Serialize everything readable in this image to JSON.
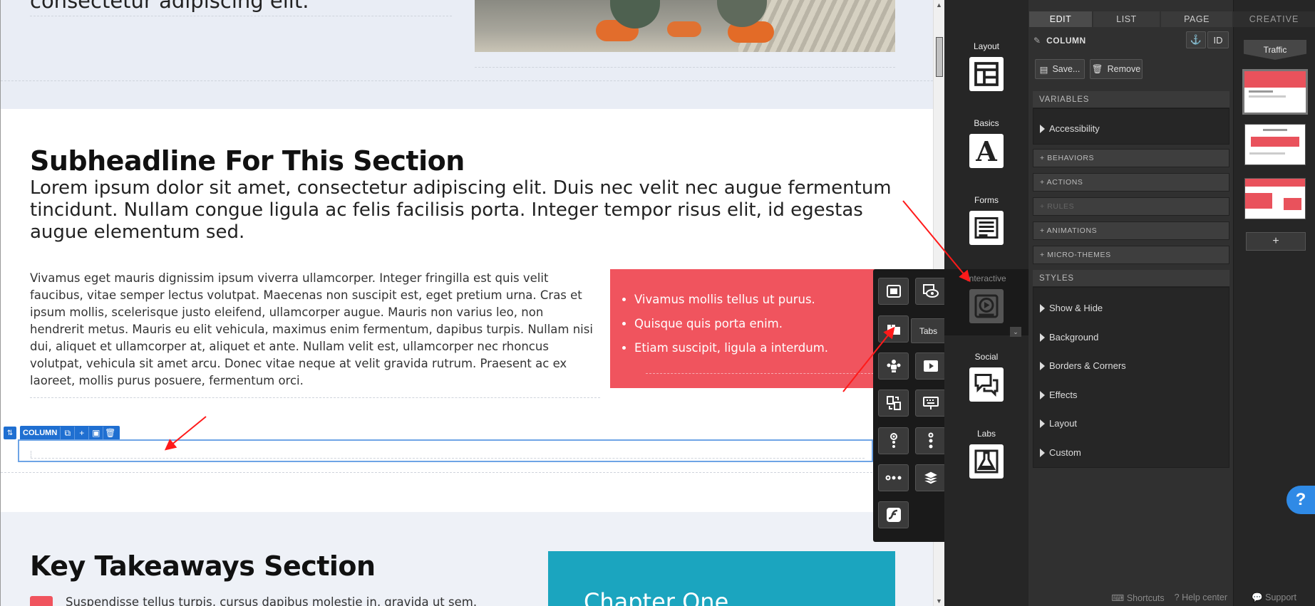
{
  "canvas": {
    "top_text": "consectetur adipiscing elit.",
    "subheadline": "Subheadline For This Section",
    "lead": "Lorem ipsum dolor sit amet, consectetur adipiscing elit. Duis nec velit nec augue fermentum tincidunt. Nullam congue ligula ac felis facilisis porta. Integer tempor risus elit, id egestas augue elementum sed.",
    "body": "Vivamus eget mauris dignissim ipsum viverra ullamcorper. Integer fringilla est quis velit faucibus, vitae semper lectus volutpat. Maecenas non suscipit est, eget pretium urna. Cras et ipsum mollis, scelerisque justo eleifend, ullamcorper augue. Mauris non varius leo, non hendrerit metus. Mauris eu elit vehicula, maximus enim fermentum, dapibus turpis. Nullam nisi dui, aliquet et ullamcorper at, aliquet et ante. Nullam velit est, ullamcorper nec rhoncus volutpat, vehicula sit amet arcu. Donec vitae neque at velit gravida rutrum. Praesent ac ex laoreet, mollis purus posuere, fermentum orci.",
    "bullets": [
      "Vivamus mollis tellus ut purus.",
      "Quisque quis porta enim.",
      "Etiam suscipit, ligula a interdum."
    ],
    "column_toolbar_label": "COLUMN",
    "key_title": "Key Takeaways Section",
    "key_item": "Suspendisse tellus turpis, cursus dapibus molestie in, gravida ut sem.",
    "chapter": "Chapter One"
  },
  "popup": {
    "tooltip": "Tabs",
    "items": [
      {
        "name": "box",
        "icon": "box-icon"
      },
      {
        "name": "reveal",
        "icon": "eye-box-icon"
      },
      {
        "name": "tabs",
        "icon": "tabs-icon"
      },
      {
        "name": "tooltip",
        "icon": "tooltip-icon"
      },
      {
        "name": "people",
        "icon": "people-icon"
      },
      {
        "name": "video",
        "icon": "video-play-icon"
      },
      {
        "name": "flip",
        "icon": "flip-card-icon"
      },
      {
        "name": "typing",
        "icon": "keyboard-icon"
      },
      {
        "name": "hotspot",
        "icon": "hotspot-icon"
      },
      {
        "name": "vertical-steps",
        "icon": "vertical-dots-icon"
      },
      {
        "name": "horizontal-steps",
        "icon": "horizontal-dots-icon"
      },
      {
        "name": "layers",
        "icon": "layers-icon"
      },
      {
        "name": "flash",
        "icon": "flash-icon"
      }
    ]
  },
  "rail": {
    "categories": [
      {
        "label": "Layout",
        "icon": "layout-icon"
      },
      {
        "label": "Basics",
        "icon": "text-a-icon"
      },
      {
        "label": "Forms",
        "icon": "form-icon"
      },
      {
        "label": "Interactive",
        "icon": "play-circle-icon"
      },
      {
        "label": "Social",
        "icon": "chat-bubbles-icon"
      },
      {
        "label": "Labs",
        "icon": "flask-icon"
      }
    ]
  },
  "panel": {
    "tabs": [
      "EDIT",
      "LIST",
      "PAGE"
    ],
    "selected": "COLUMN",
    "id_label": "ID",
    "save_label": "Save...",
    "remove_label": "Remove",
    "variables_header": "VARIABLES",
    "accessibility": "Accessibility",
    "collapsibles": [
      "+ BEHAVIORS",
      "+ ACTIONS",
      "+ RULES",
      "+ ANIMATIONS",
      "+ MICRO-THEMES"
    ],
    "styles_header": "STYLES",
    "styles": [
      "Show & Hide",
      "Background",
      "Borders & Corners",
      "Effects",
      "Layout",
      "Custom"
    ],
    "footer": {
      "shortcuts": "Shortcuts",
      "help": "Help center",
      "support": "Support"
    }
  },
  "creative": {
    "title": "CREATIVE",
    "traffic": "Traffic",
    "add": "+",
    "help": "?"
  },
  "colors": {
    "red": "#f0545e",
    "teal": "#1ba5bf",
    "blue": "#1f6fd1",
    "annotation": "#ff1a1a"
  }
}
